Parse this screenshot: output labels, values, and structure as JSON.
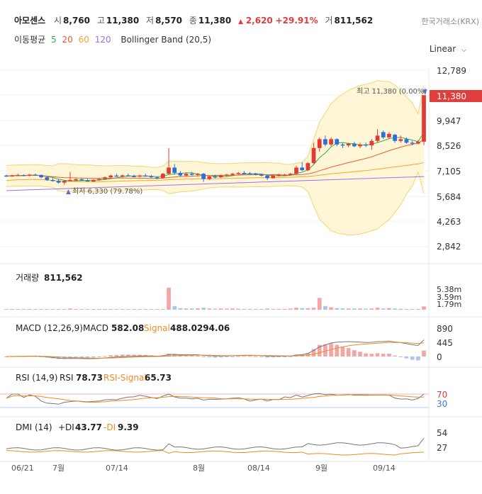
{
  "header": {
    "stock_name": "아모센스",
    "open_label": "시",
    "open": "8,760",
    "high_label": "고",
    "high": "11,380",
    "low_label": "저",
    "low": "8,570",
    "close_label": "종",
    "close": "11,380",
    "change_arrow": "▲",
    "change": "2,620",
    "change_pct": "+29.91%",
    "volume_label": "거",
    "volume": "811,562",
    "exchange": "한국거래소(KRX)"
  },
  "indicators": {
    "ma_label": "이동평균",
    "ma_periods": [
      "5",
      "20",
      "60",
      "120"
    ],
    "ma_colors": [
      "#2db34a",
      "#f05a28",
      "#f0a830",
      "#9b6ff0"
    ],
    "bb_label": "Bollinger Band (20,5)"
  },
  "scale_select": {
    "value": "Linear",
    "icon": "chevron-down-icon"
  },
  "price_axis": [
    "12,789",
    "11,380",
    "9,947",
    "8,526",
    "7,105",
    "5,684",
    "4,263",
    "2,842"
  ],
  "annotations": {
    "high": "최고 11,380 (0.00%)",
    "low": "최저 6,330 (79.78%)"
  },
  "volume_panel": {
    "label": "거래량",
    "value": "811,562",
    "axis": [
      "5.38m",
      "3.59m",
      "1.79m"
    ]
  },
  "macd_panel": {
    "label": "MACD (12,26,9)",
    "macd_label": "MACD",
    "macd_value": "582.08",
    "signal_label": "Signal",
    "signal_value": "488.0294.06",
    "axis": [
      "890",
      "445",
      "0"
    ]
  },
  "rsi_panel": {
    "label": "RSI (14,9)",
    "rsi_label": "RSI",
    "rsi_value": "78.73",
    "signal_label": "RSI-Signal",
    "signal_value": "65.73",
    "axis": [
      "70",
      "30"
    ]
  },
  "dmi_panel": {
    "label": "DMI (14)",
    "pdi_label": "+DI",
    "pdi_value": "43.77",
    "mdi_label": "-DI",
    "mdi_value": "9.39",
    "axis": [
      "54",
      "27"
    ]
  },
  "x_axis": [
    "06/21",
    "7월",
    "07/14",
    "8월",
    "08/14",
    "9월",
    "09/14"
  ],
  "chart_data": {
    "type": "candlestick",
    "ylim": [
      2842,
      12789
    ],
    "note_series": "daily OHLC, approximate",
    "candles": [
      {
        "o": 6850,
        "h": 6900,
        "l": 6780,
        "c": 6820
      },
      {
        "o": 6820,
        "h": 6900,
        "l": 6790,
        "c": 6860
      },
      {
        "o": 6860,
        "h": 6950,
        "l": 6830,
        "c": 6880
      },
      {
        "o": 6880,
        "h": 6920,
        "l": 6820,
        "c": 6840
      },
      {
        "o": 6840,
        "h": 6950,
        "l": 6800,
        "c": 6900
      },
      {
        "o": 6900,
        "h": 6960,
        "l": 6850,
        "c": 6880
      },
      {
        "o": 6880,
        "h": 6920,
        "l": 6700,
        "c": 6750
      },
      {
        "o": 6750,
        "h": 6800,
        "l": 6550,
        "c": 6600
      },
      {
        "o": 6600,
        "h": 6700,
        "l": 6500,
        "c": 6550
      },
      {
        "o": 6550,
        "h": 6650,
        "l": 6400,
        "c": 6450
      },
      {
        "o": 6450,
        "h": 6600,
        "l": 6330,
        "c": 6550
      },
      {
        "o": 6550,
        "h": 7050,
        "l": 6500,
        "c": 6600
      },
      {
        "o": 6600,
        "h": 6700,
        "l": 6520,
        "c": 6640
      },
      {
        "o": 6640,
        "h": 6700,
        "l": 6560,
        "c": 6580
      },
      {
        "o": 6580,
        "h": 6650,
        "l": 6500,
        "c": 6520
      },
      {
        "o": 6520,
        "h": 6650,
        "l": 6480,
        "c": 6600
      },
      {
        "o": 6600,
        "h": 6700,
        "l": 6550,
        "c": 6650
      },
      {
        "o": 6650,
        "h": 6800,
        "l": 6600,
        "c": 6750
      },
      {
        "o": 6750,
        "h": 6900,
        "l": 6700,
        "c": 6850
      },
      {
        "o": 6850,
        "h": 6950,
        "l": 6780,
        "c": 6800
      },
      {
        "o": 6800,
        "h": 6900,
        "l": 6750,
        "c": 6860
      },
      {
        "o": 6860,
        "h": 6950,
        "l": 6800,
        "c": 6820
      },
      {
        "o": 6820,
        "h": 6900,
        "l": 6750,
        "c": 6800
      },
      {
        "o": 6800,
        "h": 6900,
        "l": 6750,
        "c": 6850
      },
      {
        "o": 6850,
        "h": 6950,
        "l": 6800,
        "c": 6820
      },
      {
        "o": 6820,
        "h": 6880,
        "l": 6720,
        "c": 6750
      },
      {
        "o": 6750,
        "h": 6800,
        "l": 6650,
        "c": 6700
      },
      {
        "o": 6700,
        "h": 7000,
        "l": 6680,
        "c": 6950
      },
      {
        "o": 6950,
        "h": 8400,
        "l": 6900,
        "c": 7300
      },
      {
        "o": 7300,
        "h": 7500,
        "l": 6900,
        "c": 7000
      },
      {
        "o": 7000,
        "h": 7100,
        "l": 6800,
        "c": 6850
      },
      {
        "o": 6850,
        "h": 7000,
        "l": 6800,
        "c": 6950
      },
      {
        "o": 6950,
        "h": 7050,
        "l": 6850,
        "c": 6900
      },
      {
        "o": 6900,
        "h": 7000,
        "l": 6800,
        "c": 6950
      },
      {
        "o": 6950,
        "h": 7000,
        "l": 6500,
        "c": 6650
      },
      {
        "o": 6650,
        "h": 6850,
        "l": 6600,
        "c": 6800
      },
      {
        "o": 6800,
        "h": 6900,
        "l": 6700,
        "c": 6750
      },
      {
        "o": 6750,
        "h": 6900,
        "l": 6720,
        "c": 6850
      },
      {
        "o": 6850,
        "h": 6950,
        "l": 6800,
        "c": 6900
      },
      {
        "o": 6900,
        "h": 7000,
        "l": 6820,
        "c": 6950
      },
      {
        "o": 6950,
        "h": 7050,
        "l": 6880,
        "c": 7000
      },
      {
        "o": 7000,
        "h": 7100,
        "l": 6900,
        "c": 6980
      },
      {
        "o": 6980,
        "h": 7050,
        "l": 6900,
        "c": 6950
      },
      {
        "o": 6950,
        "h": 7000,
        "l": 6850,
        "c": 6900
      },
      {
        "o": 6900,
        "h": 6950,
        "l": 6800,
        "c": 6850
      },
      {
        "o": 6850,
        "h": 6900,
        "l": 6600,
        "c": 6700
      },
      {
        "o": 6700,
        "h": 6900,
        "l": 6680,
        "c": 6850
      },
      {
        "o": 6850,
        "h": 6950,
        "l": 6800,
        "c": 6880
      },
      {
        "o": 6880,
        "h": 6950,
        "l": 6820,
        "c": 6900
      },
      {
        "o": 6900,
        "h": 7000,
        "l": 6850,
        "c": 6950
      },
      {
        "o": 6950,
        "h": 7400,
        "l": 6900,
        "c": 7300
      },
      {
        "o": 7300,
        "h": 7600,
        "l": 7100,
        "c": 7150
      },
      {
        "o": 7150,
        "h": 7600,
        "l": 7100,
        "c": 7550
      },
      {
        "o": 7550,
        "h": 8700,
        "l": 7500,
        "c": 8400
      },
      {
        "o": 8400,
        "h": 9000,
        "l": 8200,
        "c": 8900
      },
      {
        "o": 8900,
        "h": 9100,
        "l": 8500,
        "c": 8600
      },
      {
        "o": 8600,
        "h": 9000,
        "l": 8500,
        "c": 8900
      },
      {
        "o": 8900,
        "h": 8950,
        "l": 8500,
        "c": 8600
      },
      {
        "o": 8600,
        "h": 8700,
        "l": 8400,
        "c": 8550
      },
      {
        "o": 8550,
        "h": 8700,
        "l": 8450,
        "c": 8650
      },
      {
        "o": 8650,
        "h": 8750,
        "l": 8450,
        "c": 8500
      },
      {
        "o": 8500,
        "h": 8700,
        "l": 8400,
        "c": 8600
      },
      {
        "o": 8600,
        "h": 8700,
        "l": 8450,
        "c": 8550
      },
      {
        "o": 8550,
        "h": 8900,
        "l": 8300,
        "c": 8800
      },
      {
        "o": 8800,
        "h": 9450,
        "l": 8700,
        "c": 9100
      },
      {
        "o": 9300,
        "h": 9400,
        "l": 8900,
        "c": 9000
      },
      {
        "o": 9000,
        "h": 9300,
        "l": 8900,
        "c": 9200
      },
      {
        "o": 9150,
        "h": 9200,
        "l": 8700,
        "c": 8800
      },
      {
        "o": 8800,
        "h": 9100,
        "l": 8700,
        "c": 8900
      },
      {
        "o": 8900,
        "h": 9000,
        "l": 8650,
        "c": 8700
      },
      {
        "o": 8700,
        "h": 8800,
        "l": 8550,
        "c": 8650
      },
      {
        "o": 8650,
        "h": 8850,
        "l": 8600,
        "c": 8750
      },
      {
        "o": 8760,
        "h": 11380,
        "l": 8570,
        "c": 11380
      }
    ],
    "volume": [
      0.05,
      0.04,
      0.03,
      0.03,
      0.04,
      0.03,
      0.05,
      0.06,
      0.04,
      0.05,
      0.06,
      0.3,
      0.05,
      0.04,
      0.03,
      0.04,
      0.05,
      0.04,
      0.05,
      0.04,
      0.03,
      0.04,
      0.03,
      0.04,
      0.03,
      0.04,
      0.05,
      0.06,
      5.38,
      0.9,
      0.4,
      0.3,
      0.3,
      0.35,
      0.5,
      0.3,
      0.25,
      0.3,
      0.25,
      0.3,
      0.25,
      0.2,
      0.2,
      0.2,
      0.2,
      0.3,
      0.2,
      0.2,
      0.2,
      0.3,
      0.5,
      0.4,
      0.4,
      0.5,
      2.9,
      0.9,
      0.6,
      0.4,
      0.35,
      0.3,
      0.3,
      0.3,
      0.25,
      0.3,
      0.5,
      0.3,
      0.4,
      0.3,
      0.25,
      0.2,
      0.2,
      0.2,
      0.811562
    ],
    "close_for_ma": true
  }
}
